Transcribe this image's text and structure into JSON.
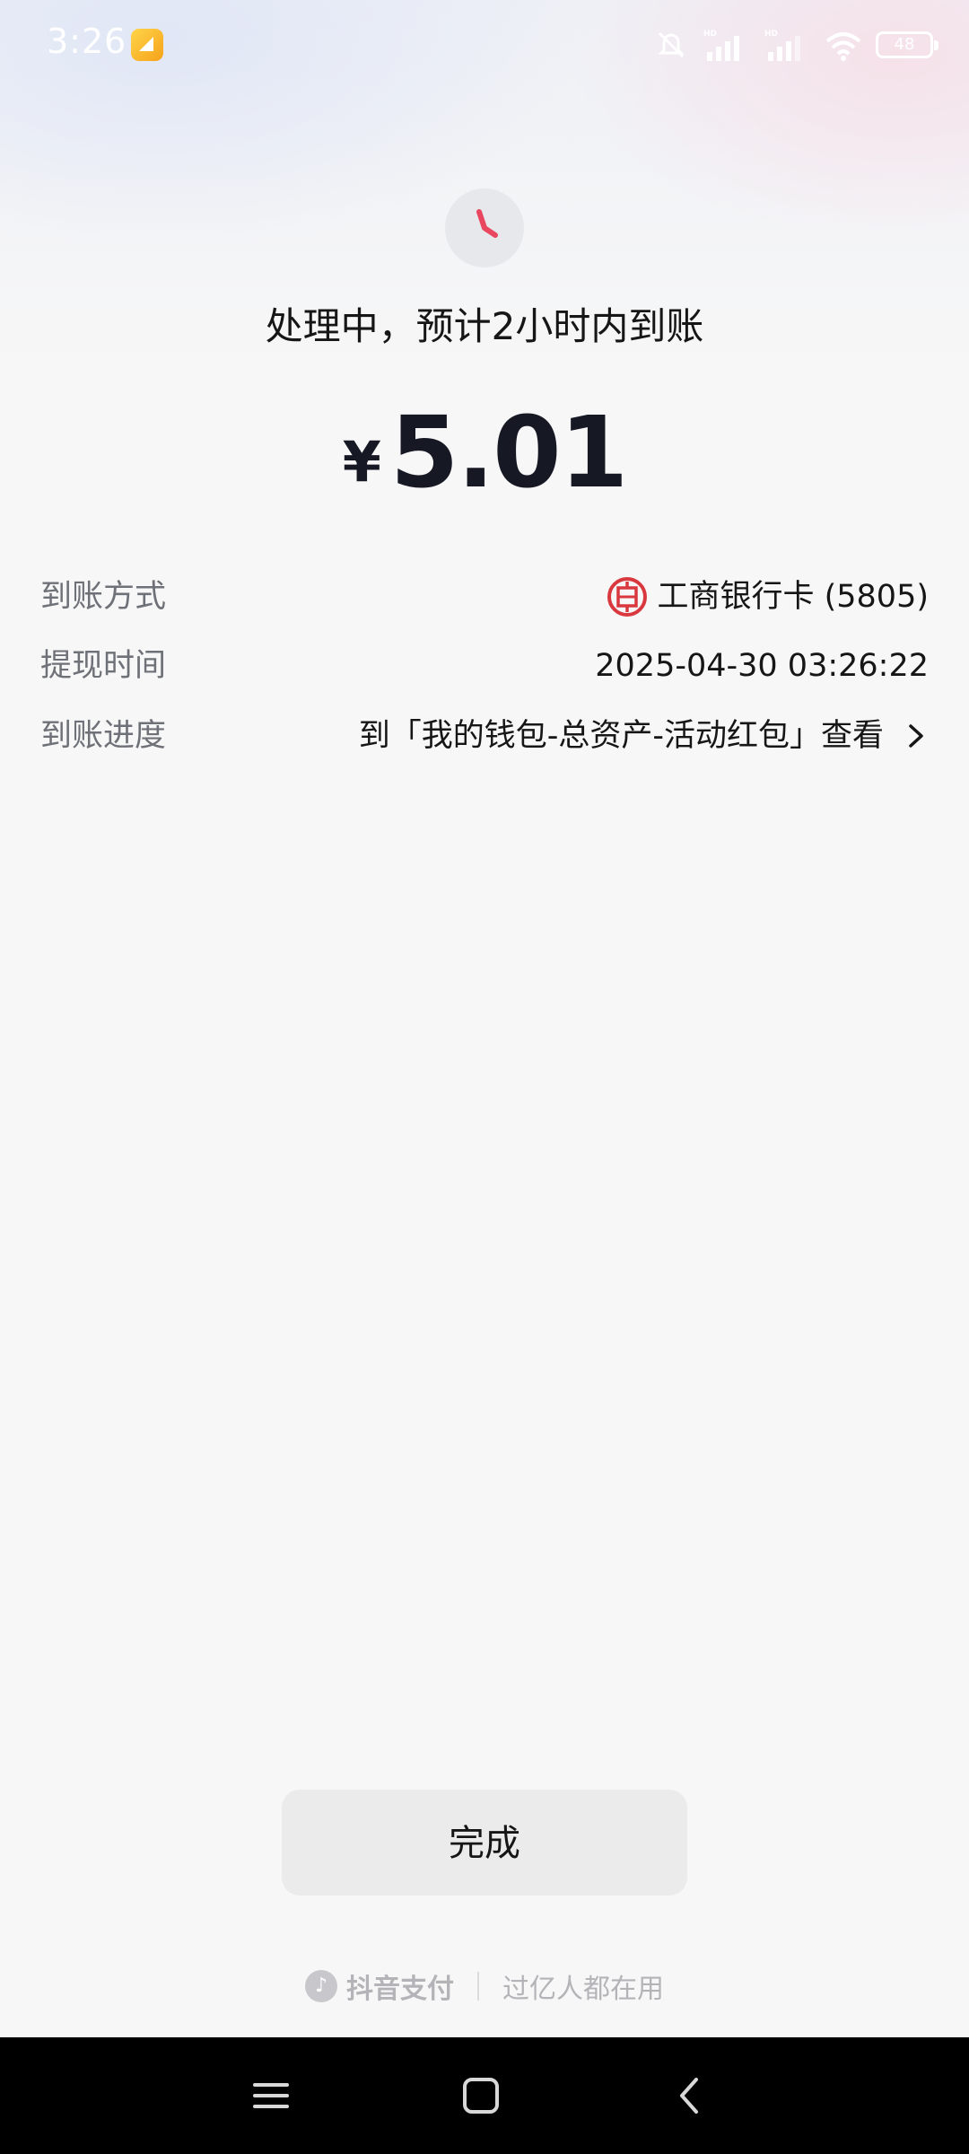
{
  "status_bar": {
    "time": "3:26",
    "battery": "48",
    "icons": [
      "app-notification-icon",
      "mute-icon",
      "hd-signal-icon",
      "hd-signal-icon",
      "wifi-icon",
      "battery-icon"
    ]
  },
  "header": {
    "status_icon": "clock-icon",
    "status_text": "处理中，预计2小时内到账",
    "currency_symbol": "¥",
    "amount": "5.01",
    "accent_color": "#e8475f"
  },
  "details": [
    {
      "label": "到账方式",
      "value": "工商银行卡 (5805)",
      "icon": "icbc-logo-icon"
    },
    {
      "label": "提现时间",
      "value": "2025-04-30 03:26:22"
    },
    {
      "label": "到账进度",
      "value": "到「我的钱包-总资产-活动红包」查看",
      "icon": "chevron-right-icon"
    }
  ],
  "actions": {
    "done_label": "完成"
  },
  "footer": {
    "brand": "抖音支付",
    "slogan": "过亿人都在用"
  },
  "nav": {
    "icons": [
      "menu-icon",
      "home-icon",
      "back-icon"
    ]
  }
}
